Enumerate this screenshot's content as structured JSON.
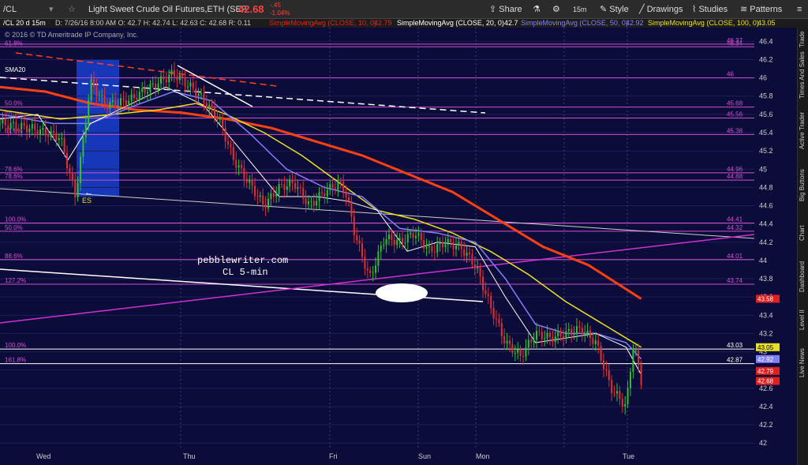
{
  "toolbar": {
    "symbol": "/CL",
    "instrument": "Light Sweet Crude Oil Futures,ETH (SEP 16)",
    "last": "42.68",
    "change": "-.45",
    "change_pct": "-1.04%",
    "share": "Share",
    "interval": "15m",
    "style": "Style",
    "drawings": "Drawings",
    "studies": "Studies",
    "patterns": "Patterns"
  },
  "infobar": {
    "desc": "/CL 20 d 15m",
    "ohlc": "D: 7/26/16 8:00 AM   O: 42.7   H: 42.74   L: 42.63   C: 42.68   R: 0.11",
    "sma10": "SimpleMovingAvg (CLOSE, 10, 0)",
    "sma10_val": "42.79",
    "sma20": "SimpleMovingAvg (CLOSE, 20, 0)",
    "sma20_val": "42.7",
    "sma50": "SimpleMovingAvg (CLOSE, 50, 0)",
    "sma50_val": "42.92",
    "sma100": "SimpleMovingAvg (CLOSE, 100, 0)",
    "sma100_val": "43.05"
  },
  "copyright": "© 2016 © TD Ameritrade IP Company, Inc.",
  "watermark": "pebblewriter.com",
  "watermark2": "CL 5-min",
  "sidebar_tabs": [
    "Trade",
    "Times And Sales",
    "Active Trader",
    "Big Buttons",
    "Chart",
    "Dashboard",
    "Level II",
    "Live News"
  ],
  "colors": {
    "background": "#0c0c3a",
    "sma10": "#e02020",
    "sma20": "#ffffff",
    "sma50": "#8080ff",
    "sma100": "#e8e020",
    "sma200": "#ff4010",
    "fib": "#d050d0",
    "bull": "#30c030",
    "bear": "#e03030"
  },
  "chart_data": {
    "type": "candlestick",
    "ylim": [
      42,
      46.5
    ],
    "y_ticks": [
      "46.4",
      "46.2",
      "46",
      "45.8",
      "45.6",
      "45.4",
      "45.2",
      "45",
      "44.8",
      "44.6",
      "44.4",
      "44.2",
      "44",
      "43.8",
      "43.6",
      "43.4",
      "43.2",
      "43",
      "42.8",
      "42.6",
      "42.4",
      "42.2",
      "42"
    ],
    "x_labels": [
      "Wed",
      "Thu",
      "Fri",
      "Sun",
      "Mon",
      "Tue"
    ],
    "series_labels": [
      {
        "text": "SMA20"
      }
    ],
    "fib_levels": [
      {
        "left": "61.8%",
        "right": "46.34",
        "value": 46.34
      },
      {
        "left": "",
        "right": "46.37",
        "value": 46.37
      },
      {
        "left": "",
        "right": "46",
        "value": 46.0
      },
      {
        "left": "50.0%",
        "right": "45.68",
        "value": 45.68
      },
      {
        "left": "70.7%",
        "right": "45.56",
        "value": 45.56
      },
      {
        "left": "61.8%",
        "right": "45.38",
        "value": 45.38
      },
      {
        "left": "78.6%",
        "right": "44.96",
        "value": 44.96
      },
      {
        "left": "78.6%",
        "right": "44.88",
        "value": 44.88
      },
      {
        "left": "100.0%",
        "right": "44.41",
        "value": 44.41
      },
      {
        "left": "50.0%",
        "right": "44.32",
        "value": 44.32
      },
      {
        "left": "88.6%",
        "right": "44.01",
        "value": 44.01
      },
      {
        "left": "127.2%",
        "right": "43.74",
        "value": 43.74
      },
      {
        "left": "100.0%",
        "right": "43.03",
        "value": 43.03
      },
      {
        "left": "161.8%",
        "right": "42.87",
        "value": 42.87
      }
    ],
    "price_tags": [
      {
        "value": 43.58,
        "text": "43.58",
        "color": "#e02020",
        "fg": "#fff"
      },
      {
        "value": 43.05,
        "text": "43.05",
        "color": "#e8e020",
        "fg": "#000"
      },
      {
        "value": 42.92,
        "text": "42.92",
        "color": "#8080ff",
        "fg": "#fff"
      },
      {
        "value": 42.79,
        "text": "42.79",
        "color": "#e02020",
        "fg": "#fff"
      },
      {
        "value": 42.68,
        "text": "42.68",
        "color": "#e02020",
        "fg": "#fff"
      }
    ],
    "sma20_path": [
      [
        0,
        45.55
      ],
      [
        0.05,
        45.6
      ],
      [
        0.09,
        45.1
      ],
      [
        0.12,
        45.5
      ],
      [
        0.17,
        45.7
      ],
      [
        0.22,
        45.9
      ],
      [
        0.27,
        45.7
      ],
      [
        0.32,
        45.2
      ],
      [
        0.37,
        44.7
      ],
      [
        0.42,
        44.7
      ],
      [
        0.46,
        44.65
      ],
      [
        0.5,
        44.55
      ],
      [
        0.54,
        44.1
      ],
      [
        0.58,
        44.2
      ],
      [
        0.63,
        44.15
      ],
      [
        0.67,
        43.6
      ],
      [
        0.71,
        43.1
      ],
      [
        0.75,
        43.15
      ],
      [
        0.79,
        43.2
      ],
      [
        0.83,
        43.05
      ],
      [
        0.85,
        42.75
      ]
    ],
    "sma50_path": [
      [
        0,
        45.6
      ],
      [
        0.07,
        45.5
      ],
      [
        0.12,
        45.5
      ],
      [
        0.18,
        45.7
      ],
      [
        0.23,
        45.85
      ],
      [
        0.28,
        45.75
      ],
      [
        0.33,
        45.4
      ],
      [
        0.38,
        45.0
      ],
      [
        0.43,
        44.8
      ],
      [
        0.48,
        44.7
      ],
      [
        0.53,
        44.35
      ],
      [
        0.58,
        44.3
      ],
      [
        0.63,
        44.2
      ],
      [
        0.67,
        43.8
      ],
      [
        0.71,
        43.3
      ],
      [
        0.75,
        43.2
      ],
      [
        0.79,
        43.2
      ],
      [
        0.83,
        43.1
      ],
      [
        0.85,
        42.92
      ]
    ],
    "sma100_path": [
      [
        0,
        45.65
      ],
      [
        0.08,
        45.55
      ],
      [
        0.15,
        45.6
      ],
      [
        0.21,
        45.65
      ],
      [
        0.26,
        45.72
      ],
      [
        0.3,
        45.6
      ],
      [
        0.35,
        45.4
      ],
      [
        0.4,
        45.15
      ],
      [
        0.45,
        44.85
      ],
      [
        0.5,
        44.55
      ],
      [
        0.55,
        44.45
      ],
      [
        0.6,
        44.3
      ],
      [
        0.65,
        44.1
      ],
      [
        0.7,
        43.85
      ],
      [
        0.75,
        43.55
      ],
      [
        0.8,
        43.3
      ],
      [
        0.85,
        43.05
      ]
    ],
    "sma200_path": [
      [
        0,
        45.9
      ],
      [
        0.06,
        45.85
      ],
      [
        0.12,
        45.72
      ],
      [
        0.18,
        45.65
      ],
      [
        0.24,
        45.62
      ],
      [
        0.3,
        45.55
      ],
      [
        0.36,
        45.45
      ],
      [
        0.42,
        45.3
      ],
      [
        0.48,
        45.15
      ],
      [
        0.54,
        44.95
      ],
      [
        0.6,
        44.75
      ],
      [
        0.66,
        44.45
      ],
      [
        0.72,
        44.15
      ],
      [
        0.78,
        43.95
      ],
      [
        0.85,
        43.58
      ]
    ],
    "price_path": [
      [
        0,
        45.5
      ],
      [
        0.04,
        45.45
      ],
      [
        0.08,
        45.35
      ],
      [
        0.1,
        44.7
      ],
      [
        0.11,
        45.3
      ],
      [
        0.12,
        45.95
      ],
      [
        0.14,
        45.7
      ],
      [
        0.17,
        45.75
      ],
      [
        0.21,
        45.95
      ],
      [
        0.23,
        46.05
      ],
      [
        0.26,
        45.85
      ],
      [
        0.29,
        45.55
      ],
      [
        0.31,
        45.1
      ],
      [
        0.33,
        44.85
      ],
      [
        0.35,
        44.6
      ],
      [
        0.37,
        44.8
      ],
      [
        0.39,
        44.85
      ],
      [
        0.41,
        44.6
      ],
      [
        0.43,
        44.75
      ],
      [
        0.45,
        44.85
      ],
      [
        0.46,
        44.7
      ],
      [
        0.47,
        44.3
      ],
      [
        0.49,
        43.8
      ],
      [
        0.51,
        44.25
      ],
      [
        0.53,
        44.2
      ],
      [
        0.55,
        44.3
      ],
      [
        0.57,
        44.1
      ],
      [
        0.59,
        44.2
      ],
      [
        0.61,
        44.15
      ],
      [
        0.63,
        43.95
      ],
      [
        0.65,
        43.5
      ],
      [
        0.67,
        43.1
      ],
      [
        0.69,
        42.95
      ],
      [
        0.71,
        43.2
      ],
      [
        0.73,
        43.15
      ],
      [
        0.75,
        43.2
      ],
      [
        0.77,
        43.25
      ],
      [
        0.79,
        43.1
      ],
      [
        0.81,
        42.6
      ],
      [
        0.83,
        42.4
      ],
      [
        0.84,
        43.1
      ],
      [
        0.85,
        42.68
      ]
    ]
  }
}
